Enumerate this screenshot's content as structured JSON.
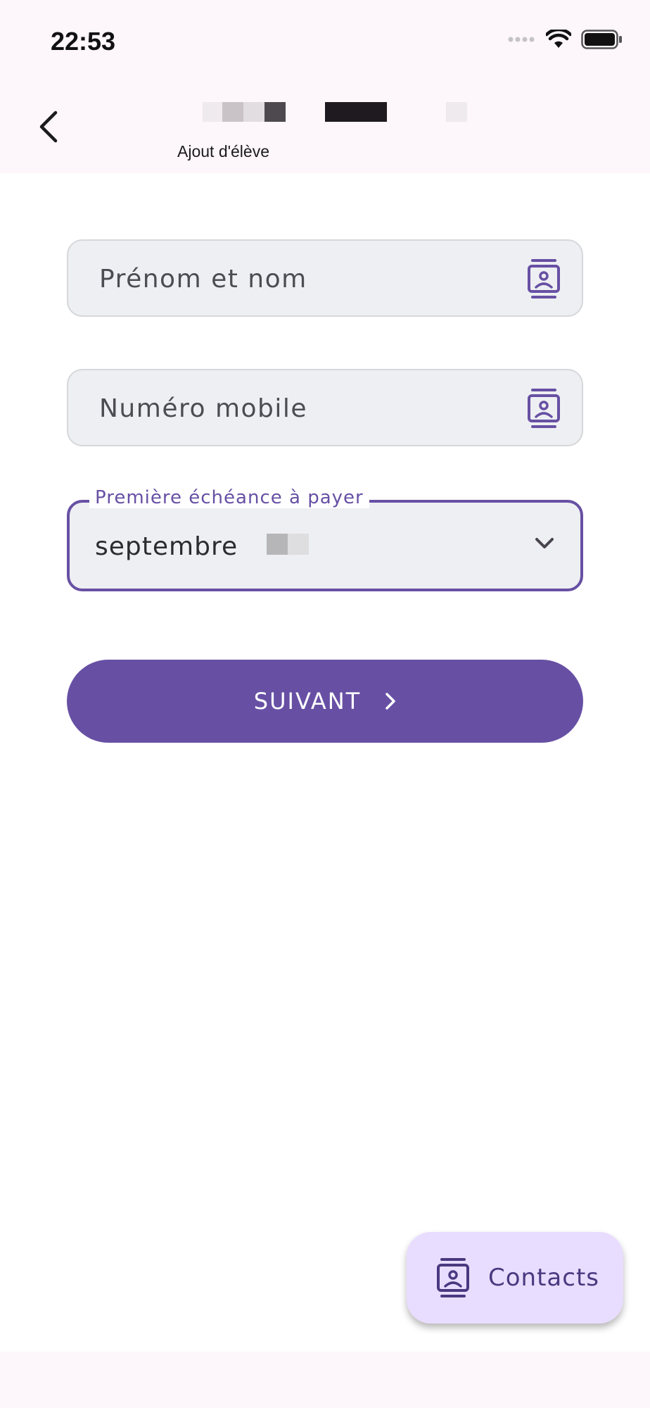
{
  "status_bar": {
    "time": "22:53",
    "icons": [
      "cellular-signal-icon",
      "wifi-icon",
      "battery-icon"
    ]
  },
  "app_bar": {
    "back_icon": "chevron-left-icon",
    "subtitle": "Ajout d'élève"
  },
  "form": {
    "name_field": {
      "placeholder": "Prénom et nom",
      "icon": "contact-card-icon"
    },
    "phone_field": {
      "placeholder": "Numéro mobile",
      "icon": "contact-card-icon"
    },
    "due_dropdown": {
      "label": "Première échéance à payer",
      "value": "septembre",
      "icon": "chevron-down-icon"
    },
    "next_button": {
      "label": "SUIVANT",
      "icon": "chevron-right-icon"
    }
  },
  "fab": {
    "label": "Contacts",
    "icon": "contact-card-icon"
  },
  "colors": {
    "primary": "#6750a4",
    "fab_background": "#e9ddff",
    "field_background": "#eeeff2",
    "bar_background": "#fdf6fb"
  }
}
